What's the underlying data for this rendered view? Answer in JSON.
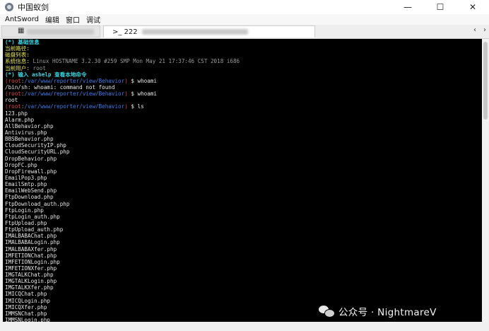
{
  "window": {
    "title": "中国蚁剑",
    "minimize_glyph": "—",
    "maximize_glyph": "☐",
    "close_glyph": "✕"
  },
  "menu": [
    "AntSword",
    "编辑",
    "窗口",
    "调试"
  ],
  "tabs": {
    "tab1_icon": "▦",
    "tab2_prefix": ">_ 222",
    "scroll_left": "‹",
    "scroll_right": "›"
  },
  "terminal": {
    "header": [
      {
        "text": "(*) 基础信息",
        "style": "cyan"
      },
      {
        "text": "当前路径: ",
        "style": "yellow"
      },
      {
        "text": "磁盘列表: ",
        "style": "yellow"
      },
      {
        "label": "系统信息: ",
        "value": "Linux HOSTNAME 3.2.30 #259 SMP Mon May 21 17:37:46 CST 2018 i686"
      },
      {
        "label": "当前用户: ",
        "value": "root"
      },
      {
        "text": "(*) 输入 ashelp 查看本地命令",
        "style": "cyan"
      }
    ],
    "prompt": {
      "user": "root",
      "host_sep": ":",
      "path": "/var/www/reporter/view/Behavior",
      "symbol": "$"
    },
    "commands": [
      {
        "cmd": "whoami",
        "output": [
          "/bin/sh: whoami: command not found"
        ]
      },
      {
        "cmd": "whoami",
        "output": [
          "root"
        ]
      },
      {
        "cmd": "ls",
        "output": [
          "123.php",
          "Alarm.php",
          "AllBehavior.php",
          "Antivirus.php",
          "BBSBehavior.php",
          "CloudSecurityIP.php",
          "CloudSecurityURL.php",
          "DropBehavior.php",
          "DropFC.php",
          "DropFirewall.php",
          "EmailPop3.php",
          "EmailSmtp.php",
          "EmailWebSend.php",
          "FtpDownload.php",
          "FtpDownload_auth.php",
          "FtpLogin.php",
          "FtpLogin_auth.php",
          "FtpUpload.php",
          "FtpUpload_auth.php",
          "IMALBABAChat.php",
          "IMALBABALogin.php",
          "IMALBABAXfer.php",
          "IMFETIONChat.php",
          "IMFETIONLogin.php",
          "IMFETIONXfer.php",
          "IMGTALKChat.php",
          "IMGTALKLogin.php",
          "IMGTALKXfer.php",
          "IMICQChat.php",
          "IMICQLogin.php",
          "IMICQXfer.php",
          "IMMSNChat.php",
          "IMMSNLogin.php"
        ]
      }
    ]
  },
  "watermark": {
    "text": "公众号 · NightmareV"
  }
}
